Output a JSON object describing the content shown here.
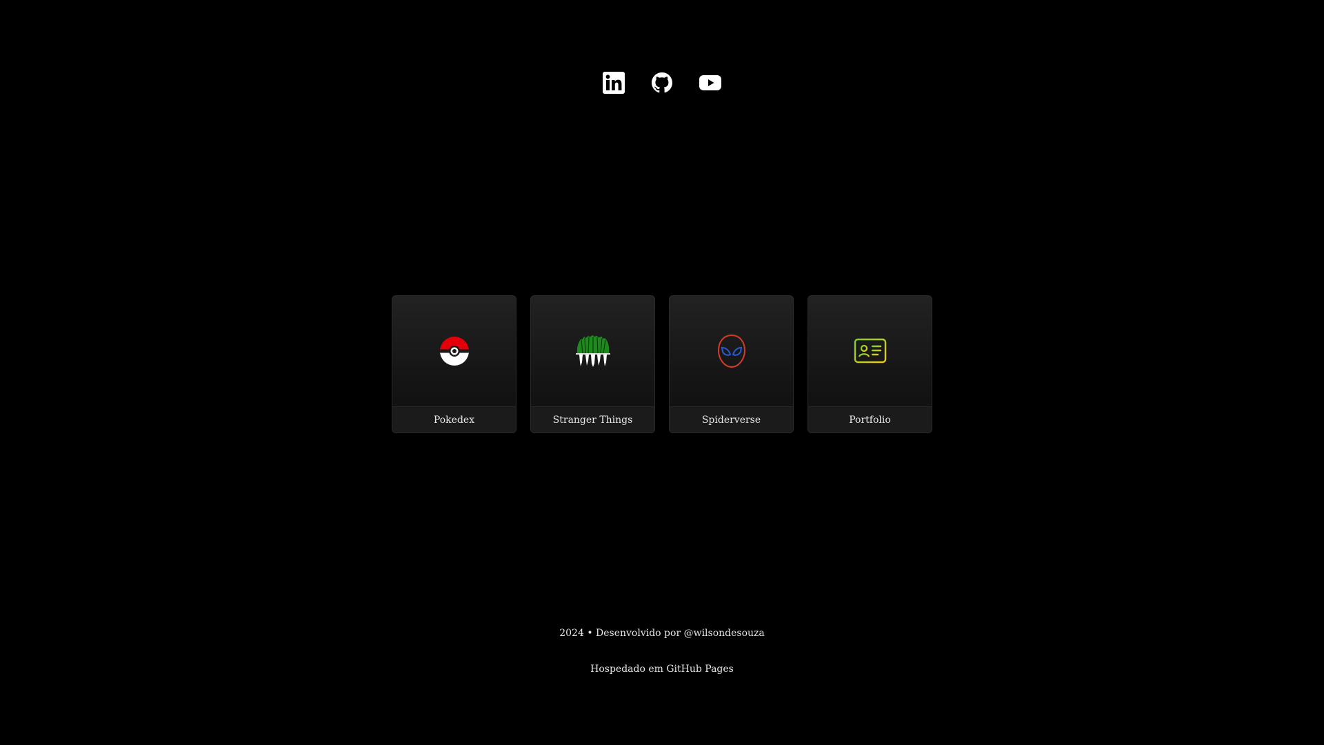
{
  "social": {
    "icons": [
      "linkedin-icon",
      "github-icon",
      "youtube-icon"
    ]
  },
  "cards": [
    {
      "label": "Pokedex",
      "icon": "pokeball-icon"
    },
    {
      "label": "Stranger Things",
      "icon": "stranger-things-icon"
    },
    {
      "label": "Spiderverse",
      "icon": "spider-mask-icon"
    },
    {
      "label": "Portfolio",
      "icon": "id-card-icon"
    }
  ],
  "colors": {
    "background": "#000000",
    "card": "#1b1b1b",
    "pokeball_red": "#e3000b",
    "stranger_green": "#1e8a1e",
    "spider_red": "#d63b2a",
    "spider_blue": "#2a5bd6",
    "portfolio_green": "#7ccf2e",
    "portfolio_yellow": "#f2c81c"
  },
  "footer": {
    "credits": "2024 • Desenvolvido por @wilsondesouza",
    "hosting": "Hospedado em GitHub Pages"
  }
}
